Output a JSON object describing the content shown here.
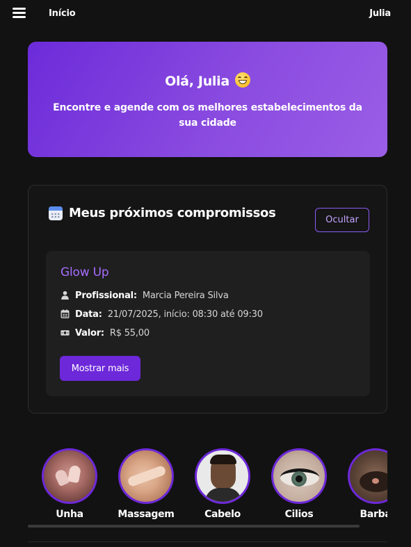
{
  "topbar": {
    "title": "Início",
    "user": "Julia"
  },
  "hero": {
    "greeting": "Olá, Julia",
    "emoji": "grinning-face-icon",
    "subtitle": "Encontre e agende com os melhores estabelecimentos da sua cidade"
  },
  "appointments": {
    "title": "Meus próximos compromissos",
    "hide_label": "Ocultar",
    "item": {
      "name": "Glow Up",
      "professional_label": "Profissional:",
      "professional": "Marcia Pereira Silva",
      "date_label": "Data:",
      "date": "21/07/2025, início: 08:30 até 09:30",
      "value_label": "Valor:",
      "value": "R$ 55,00",
      "more_label": "Mostrar mais"
    }
  },
  "categories": [
    {
      "label": "Unha"
    },
    {
      "label": "Massagem"
    },
    {
      "label": "Cabelo"
    },
    {
      "label": "Cilios"
    },
    {
      "label": "Barba"
    }
  ],
  "colors": {
    "accent": "#6d28d9",
    "accent_light": "#a66cff",
    "background": "#121212"
  }
}
